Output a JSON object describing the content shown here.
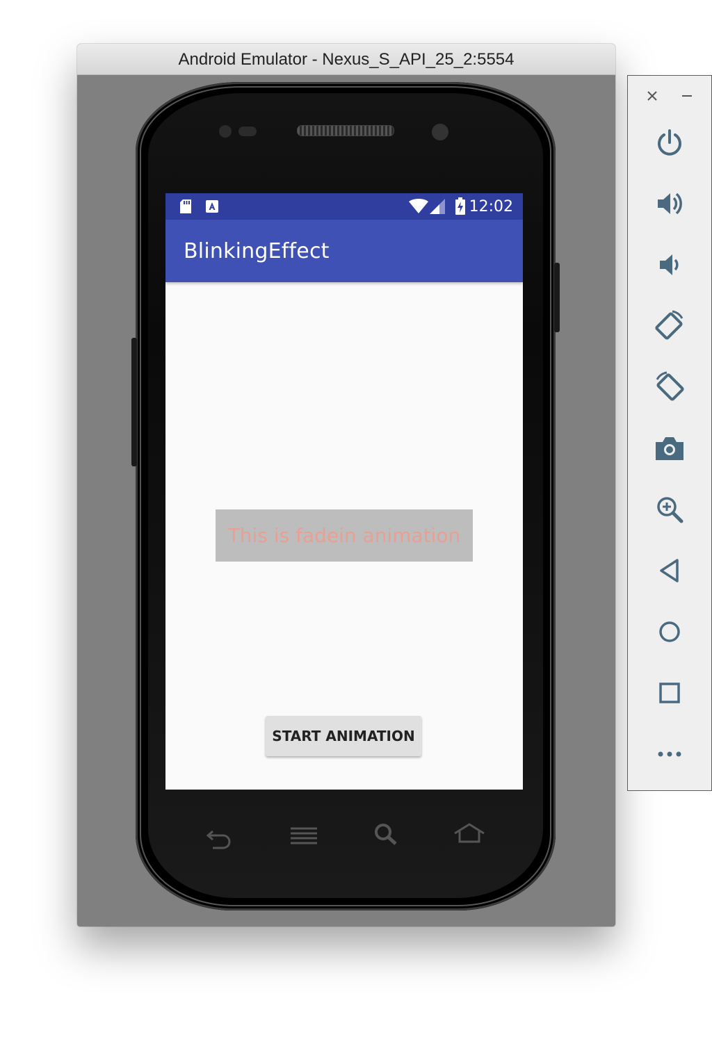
{
  "window": {
    "title": "Android Emulator - Nexus_S_API_25_2:5554"
  },
  "statusbar": {
    "time": "12:02",
    "icons": [
      "sd-card-icon",
      "keyboard-a-icon",
      "wifi-icon",
      "signal-icon",
      "battery-charging-icon"
    ]
  },
  "app": {
    "title": "BlinkingEffect",
    "fade_text": "This is fadein animation",
    "button_label": "START ANIMATION"
  },
  "phone_keys": [
    "back-key-icon",
    "menu-key-icon",
    "search-key-icon",
    "home-key-icon"
  ],
  "toolbar": {
    "items": [
      "close-icon",
      "minimize-icon",
      "power-icon",
      "volume-up-icon",
      "volume-down-icon",
      "rotate-left-icon",
      "rotate-right-icon",
      "camera-icon",
      "zoom-icon",
      "back-icon",
      "home-icon",
      "overview-icon",
      "more-icon"
    ]
  },
  "colors": {
    "status_bar": "#303f9f",
    "app_bar": "#3f51b5",
    "fade_text": "#f29a8c",
    "fade_box": "#bdbdbd",
    "toolbar_icon": "#4a6a80"
  }
}
